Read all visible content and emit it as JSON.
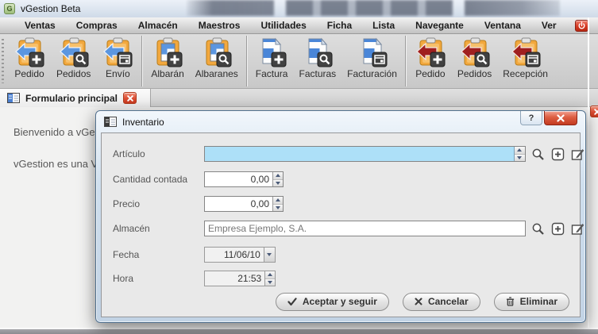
{
  "window": {
    "title": "vGestion Beta",
    "app_icon_letter": "G"
  },
  "menu": {
    "items": [
      "Ventas",
      "Compras",
      "Almacén",
      "Maestros",
      "Utilidades",
      "Ficha",
      "Lista",
      "Navegante",
      "Ventana",
      "Ver"
    ],
    "power_icon": "power-icon"
  },
  "toolbar": {
    "items": [
      {
        "label": "Pedido",
        "icon": "clipboard-blue-arrow-add-icon"
      },
      {
        "label": "Pedidos",
        "icon": "clipboard-blue-arrow-search-icon"
      },
      {
        "label": "Envío",
        "icon": "clipboard-blue-arrow-window-icon"
      },
      {
        "label": "Albarán",
        "icon": "clipboard-document-add-icon"
      },
      {
        "label": "Albaranes",
        "icon": "clipboard-document-search-icon"
      },
      {
        "label": "Factura",
        "icon": "document-add-icon"
      },
      {
        "label": "Facturas",
        "icon": "document-search-icon"
      },
      {
        "label": "Facturación",
        "icon": "document-window-icon"
      },
      {
        "label": "Pedido",
        "icon": "clipboard-red-arrow-add-icon"
      },
      {
        "label": "Pedidos",
        "icon": "clipboard-red-arrow-search-icon"
      },
      {
        "label": "Recepción",
        "icon": "clipboard-red-arrow-window-icon"
      }
    ]
  },
  "tab": {
    "label": "Formulario principal",
    "close_icon": "close-icon"
  },
  "content": {
    "welcome_line1": "Bienvenido a vGes",
    "welcome_line2": "vGestion es una V"
  },
  "dialog": {
    "title": "Inventario",
    "help_label": "?",
    "fields": {
      "articulo": {
        "label": "Artículo",
        "value": ""
      },
      "cantidad": {
        "label": "Cantidad contada",
        "value": "0,00"
      },
      "precio": {
        "label": "Precio",
        "value": "0,00"
      },
      "almacen": {
        "label": "Almacén",
        "value": "Empresa Ejemplo, S.A."
      },
      "fecha": {
        "label": "Fecha",
        "value": "11/06/10"
      },
      "hora": {
        "label": "Hora",
        "value": "21:53"
      }
    },
    "field_icons": [
      "search-icon",
      "add-icon",
      "edit-icon"
    ],
    "buttons": {
      "accept": "Aceptar y seguir",
      "cancel": "Cancelar",
      "delete": "Eliminar"
    }
  },
  "colors": {
    "focused_field": "#ade0f8",
    "clipboard_orange": "#f2a83e",
    "arrow_blue": "#5b96e0",
    "arrow_red": "#a01f1f",
    "close_red": "#c33b20",
    "aero_frame": "#cfdfee"
  }
}
